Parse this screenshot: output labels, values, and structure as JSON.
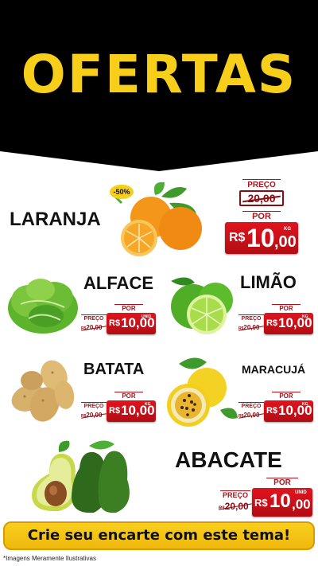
{
  "header": {
    "title": "OFERTAS",
    "bg_color": "#000000",
    "title_color": "#f7cf1a"
  },
  "products": [
    {
      "name": "LARANJA",
      "badge": "-50%",
      "preco_label": "PREÇO",
      "old_price": "20,00",
      "por_label": "POR",
      "currency": "R$",
      "new_price": "10",
      "new_cents": ",00",
      "unit": "KG"
    },
    {
      "name": "ALFACE",
      "preco_label": "PREÇO",
      "old_currency": "R$",
      "old_price": "20,00",
      "por_label": "POR",
      "currency": "R$",
      "new_price": "10,00",
      "unit": "UNID"
    },
    {
      "name": "LIMÃO",
      "preco_label": "PREÇO",
      "old_currency": "R$",
      "old_price": "20,00",
      "por_label": "POR",
      "currency": "R$",
      "new_price": "10,00",
      "unit": "KG"
    },
    {
      "name": "BATATA",
      "preco_label": "PREÇO",
      "old_currency": "R$",
      "old_price": "20,00",
      "por_label": "POR",
      "currency": "R$",
      "new_price": "10,00",
      "unit": "KG"
    },
    {
      "name": "MARACUJÁ",
      "preco_label": "PREÇO",
      "old_currency": "R$",
      "old_price": "20,00",
      "por_label": "POR",
      "currency": "R$",
      "new_price": "10,00",
      "unit": "KG"
    },
    {
      "name": "ABACATE",
      "preco_label": "PREÇO",
      "old_currency": "R$",
      "old_price": "20,00",
      "por_label": "POR",
      "currency": "R$",
      "new_price": "10",
      "new_cents": ",00",
      "unit": "UNID"
    }
  ],
  "cta": {
    "label": "Crie seu encarte com este tema!"
  },
  "footer": {
    "note": "*Imagens Meramente Ilustrativas"
  },
  "icons": [
    "orange-fruit-icon",
    "lettuce-icon",
    "lime-icon",
    "potato-icon",
    "passion-fruit-icon",
    "avocado-icon"
  ]
}
